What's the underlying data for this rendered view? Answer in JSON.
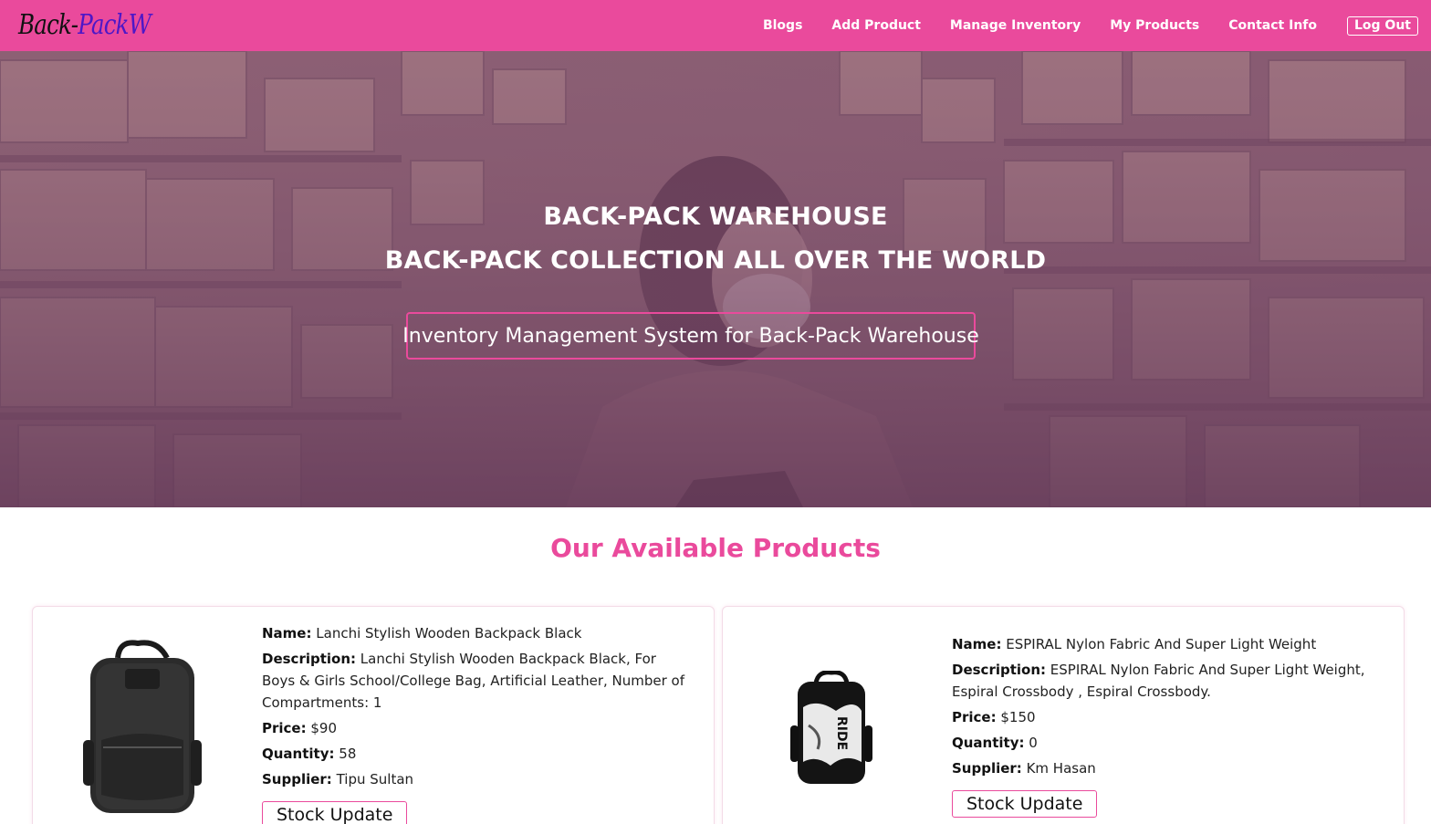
{
  "navbar": {
    "brand_part1": "Back-",
    "brand_part2": "PackW",
    "links": [
      "Blogs",
      "Add Product",
      "Manage Inventory",
      "My Products",
      "Contact Info"
    ],
    "logout_label": "Log Out"
  },
  "hero": {
    "title_line1": "BACK-PACK WAREHOUSE",
    "title_line2": "BACK-PACK COLLECTION ALL OVER THE WORLD",
    "tagline": "Inventory Management System for Back-Pack Warehouse"
  },
  "products_section": {
    "title": "Our Available Products",
    "labels": {
      "name": "Name:",
      "description": "Description:",
      "price": "Price:",
      "quantity": "Quantity:",
      "supplier": "Supplier:"
    },
    "stock_button_label": "Stock Update",
    "items": [
      {
        "name": "Lanchi Stylish Wooden Backpack Black",
        "description": "Lanchi Stylish Wooden Backpack Black, For Boys & Girls School/College Bag, Artificial Leather, Number of Compartments: 1",
        "price": "$90",
        "quantity": "58",
        "supplier": "Tipu Sultan"
      },
      {
        "name": "ESPIRAL Nylon Fabric And Super Light Weight",
        "description": "ESPIRAL Nylon Fabric And Super Light Weight, Espiral Crossbody , Espiral Crossbody.",
        "price": "$150",
        "quantity": "0",
        "supplier": "Km Hasan",
        "image_print": "RIDE"
      }
    ]
  },
  "colors": {
    "accent": "#ea4a9c",
    "brand_secondary": "#4d17c7",
    "hero_overlay": "#6e375f"
  }
}
